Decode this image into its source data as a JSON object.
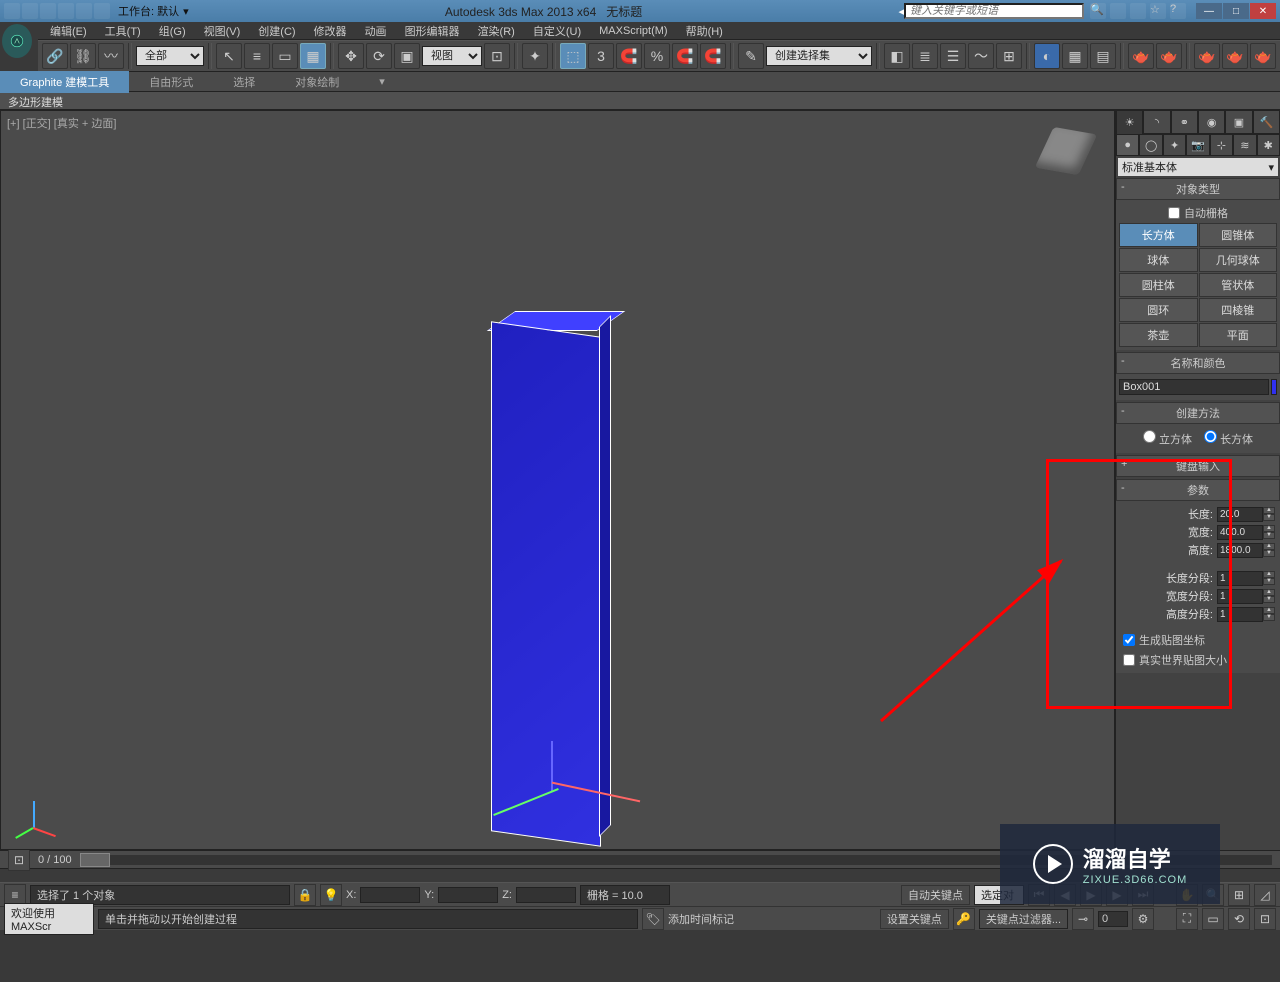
{
  "titlebar": {
    "workspace_label": "工作台: 默认",
    "app_title": "Autodesk 3ds Max  2013 x64",
    "doc_title": "无标题",
    "search_placeholder": "键入关键字或短语"
  },
  "menus": [
    "编辑(E)",
    "工具(T)",
    "组(G)",
    "视图(V)",
    "创建(C)",
    "修改器",
    "动画",
    "图形编辑器",
    "渲染(R)",
    "自定义(U)",
    "MAXScript(M)",
    "帮助(H)"
  ],
  "toolbar": {
    "filter_select": "全部",
    "view_select": "视图",
    "named_sel": "创建选择集"
  },
  "ribbon": {
    "tabs": [
      "Graphite 建模工具",
      "自由形式",
      "选择",
      "对象绘制"
    ],
    "sub": "多边形建模"
  },
  "viewport": {
    "label": "[+] [正交] [真实 + 边面]"
  },
  "cmdpanel": {
    "category": "标准基本体",
    "obj_types_header": "对象类型",
    "auto_grid": "自动栅格",
    "objects": [
      {
        "l": "长方体",
        "r": "圆锥体",
        "active": "l"
      },
      {
        "l": "球体",
        "r": "几何球体"
      },
      {
        "l": "圆柱体",
        "r": "管状体"
      },
      {
        "l": "圆环",
        "r": "四棱锥"
      },
      {
        "l": "茶壶",
        "r": "平面"
      }
    ],
    "name_header": "名称和颜色",
    "name_value": "Box001",
    "creation_header": "创建方法",
    "creation_options": [
      "立方体",
      "长方体"
    ],
    "keyboard_header": "键盘输入",
    "params_header": "参数",
    "params": {
      "length_label": "长度:",
      "length": "20.0",
      "width_label": "宽度:",
      "width": "400.0",
      "height_label": "高度:",
      "height": "1800.0",
      "lsegs_label": "长度分段:",
      "lsegs": "1",
      "wsegs_label": "宽度分段:",
      "wsegs": "1",
      "hsegs_label": "高度分段:",
      "hsegs": "1",
      "gen_map": "生成贴图坐标",
      "real_world": "真实世界贴图大小"
    }
  },
  "timeline": {
    "range": "0 / 100"
  },
  "status": {
    "selection": "选择了 1 个对象",
    "prompt": "单击并拖动以开始创建过程",
    "welcome": "欢迎使用  MAXScr",
    "x": "",
    "y": "",
    "z": "",
    "grid": "栅格 = 10.0",
    "add_time_tag": "添加时间标记",
    "auto_key": "自动关键点",
    "set_key": "设置关键点",
    "selected": "选定对",
    "key_filter": "关键点过滤器..."
  },
  "watermark": {
    "brand": "溜溜自学",
    "url": "ZIXUE.3D66.COM"
  },
  "annotation": {
    "highlight": "params"
  }
}
